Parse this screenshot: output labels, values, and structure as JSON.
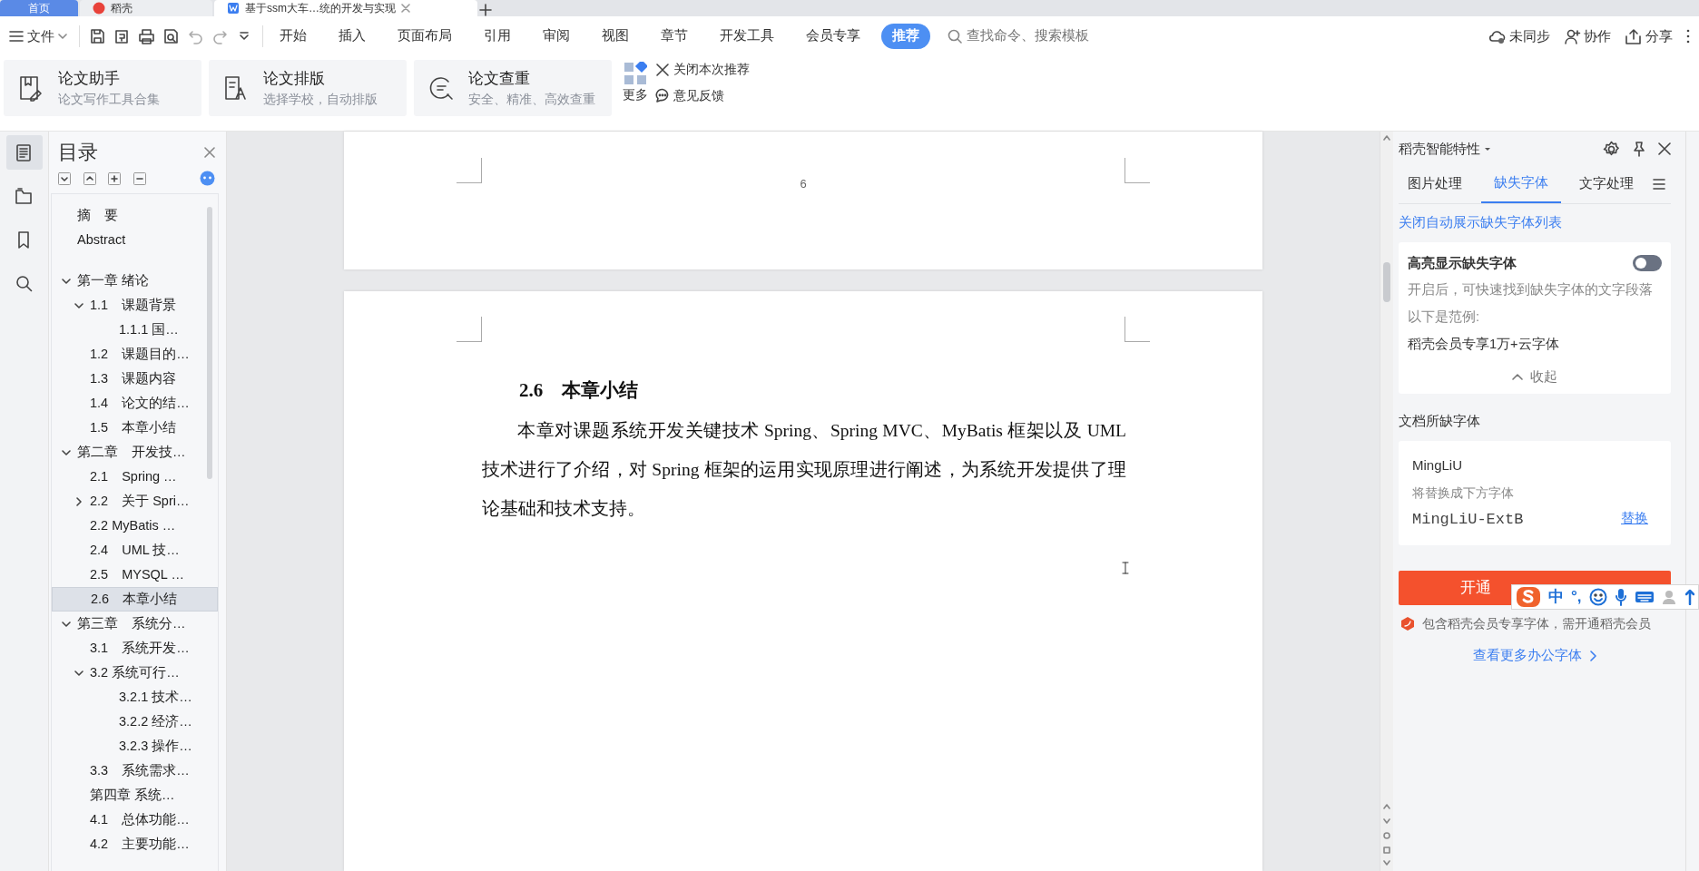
{
  "title_tabs": [
    {
      "kind": "home",
      "label": "首页",
      "selected": false
    },
    {
      "kind": "app",
      "label": "稻壳",
      "selected": false
    },
    {
      "kind": "doc",
      "label": "基于ssm大车…统的开发与实现",
      "selected": true
    }
  ],
  "menu": {
    "file_label": "文件",
    "tabs": [
      {
        "label": "开始",
        "selected": false
      },
      {
        "label": "插入",
        "selected": false
      },
      {
        "label": "页面布局",
        "selected": false
      },
      {
        "label": "引用",
        "selected": false
      },
      {
        "label": "审阅",
        "selected": false
      },
      {
        "label": "视图",
        "selected": false
      },
      {
        "label": "章节",
        "selected": false
      },
      {
        "label": "开发工具",
        "selected": false
      },
      {
        "label": "会员专享",
        "selected": false
      },
      {
        "label": "推荐",
        "selected": true
      }
    ],
    "search": {
      "placeholder": "查找命令、搜索模板"
    },
    "actions": [
      {
        "kind": "sync",
        "label": "未同步"
      },
      {
        "kind": "collab",
        "label": "协作"
      },
      {
        "kind": "share",
        "label": "分享"
      }
    ]
  },
  "ribbon": {
    "cards": [
      {
        "kind": "assistant",
        "title": "论文助手",
        "subtitle": "论文写作工具合集"
      },
      {
        "kind": "layout",
        "title": "论文排版",
        "subtitle": "选择学校，自动排版"
      },
      {
        "kind": "check",
        "title": "论文查重",
        "subtitle": "安全、精准、高效查重"
      }
    ],
    "more_label": "更多",
    "close_label": "关闭本次推荐",
    "feedback_label": "意见反馈"
  },
  "rail": [
    {
      "kind": "toc",
      "selected": true
    },
    {
      "kind": "outline",
      "selected": false
    },
    {
      "kind": "bookmark",
      "selected": false
    },
    {
      "kind": "search",
      "selected": false
    }
  ],
  "toc": {
    "title": "目录",
    "items": [
      {
        "label": "摘　要",
        "selected": false
      },
      {
        "label": "Abstract",
        "selected": false
      },
      {
        "label": "第一章  绪论",
        "selected": false,
        "expanded": true,
        "children": [
          {
            "label": "1.1　课题背景",
            "selected": false,
            "expanded": true,
            "children": [
              {
                "label": "1.1.1 国…",
                "selected": false
              }
            ]
          },
          {
            "label": "1.2　课题目的…",
            "selected": false
          },
          {
            "label": "1.3　课题内容",
            "selected": false
          },
          {
            "label": "1.4　论文的结…",
            "selected": false
          },
          {
            "label": "1.5　本章小结",
            "selected": false
          }
        ]
      },
      {
        "label": "第二章　开发技…",
        "selected": false,
        "expanded": true,
        "children": [
          {
            "label": "2.1　Spring …",
            "selected": false
          },
          {
            "label": "2.2　关于 Spri…",
            "selected": false,
            "expanded": false
          },
          {
            "label": "2.2  MyBatis …",
            "selected": false
          },
          {
            "label": "2.4　UML 技…",
            "selected": false
          },
          {
            "label": "2.5　MYSQL …",
            "selected": false
          },
          {
            "label": "2.6　本章小结",
            "selected": true
          }
        ]
      },
      {
        "label": "第三章　系统分…",
        "selected": false,
        "expanded": true,
        "children": [
          {
            "label": "3.1　系统开发…",
            "selected": false
          },
          {
            "label": "3.2 系统可行…",
            "selected": false,
            "expanded": true,
            "children": [
              {
                "label": "3.2.1 技术…",
                "selected": false
              },
              {
                "label": "3.2.2 经济…",
                "selected": false
              },
              {
                "label": "3.2.3 操作…",
                "selected": false
              }
            ]
          },
          {
            "label": "3.3　系统需求…",
            "selected": false
          },
          {
            "label": "第四章  系统…",
            "selected": false
          },
          {
            "label": "4.1　总体功能…",
            "selected": false
          },
          {
            "label": "4.2　主要功能…",
            "selected": false
          }
        ]
      }
    ]
  },
  "document": {
    "page_number": "6",
    "heading": "2.6　本章小结",
    "paragraph": "本章对课题系统开发关键技术 Spring、Spring MVC、MyBatis 框架以及 UML 技术进行了介绍，对 Spring 框架的运用实现原理进行阐述，为系统开发提供了理论基础和技术支持。"
  },
  "panel": {
    "title": "稻壳智能特性",
    "tabs": [
      {
        "label": "图片处理",
        "selected": false
      },
      {
        "label": "缺失字体",
        "selected": true
      },
      {
        "label": "文字处理",
        "selected": false
      }
    ],
    "close_link": "关闭自动展示缺失字体列表",
    "highlight": {
      "title": "高亮显示缺失字体",
      "on": false,
      "description": "开启后，可快速找到缺失字体的文字段落",
      "example_label": "以下是范例:",
      "example": "稻壳会员专享1万+云字体",
      "collapse_label": "收起"
    },
    "missing_title": "文档所缺字体",
    "font": {
      "name": "MingLiU",
      "replace_hint": "将替换成下方字体",
      "replacement": "MingLiU-ExtB",
      "replace_link": "替换"
    },
    "open_button": "开通",
    "notice": "包含稻壳会员专享字体，需开通稻壳会员",
    "more_link": "查看更多办公字体"
  },
  "ime": {
    "mode": "中",
    "punct": "°,"
  }
}
